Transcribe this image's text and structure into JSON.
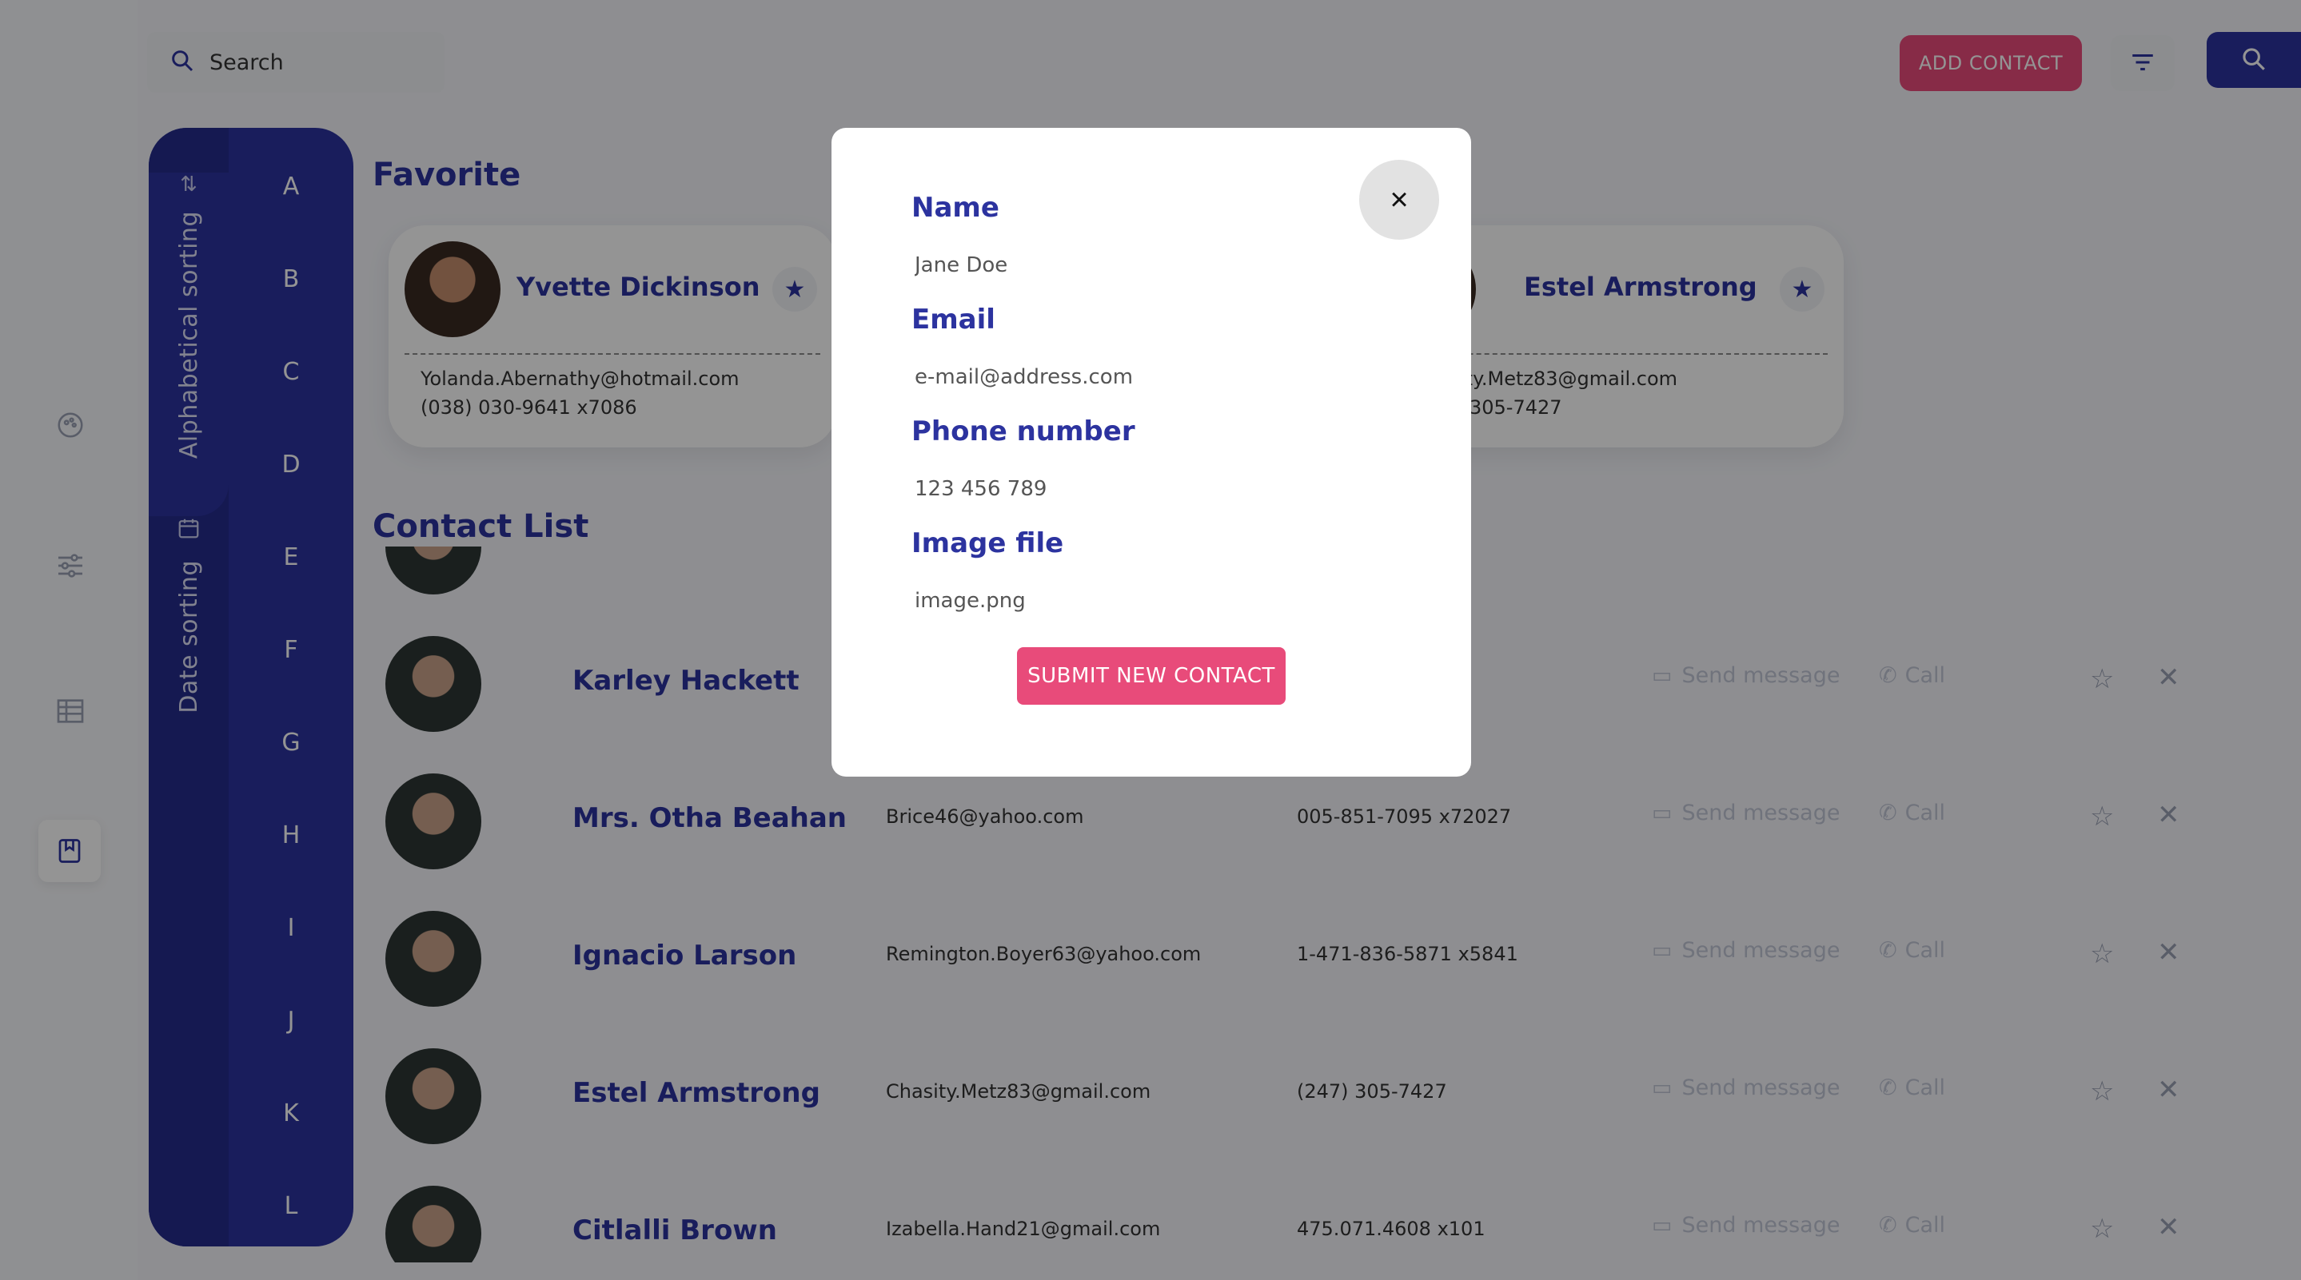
{
  "search": {
    "placeholder": "Search"
  },
  "header": {
    "add_contact_label": "ADD CONTACT"
  },
  "sidebar_icons": [
    "palette-icon",
    "sliders-icon",
    "list-icon",
    "bookmark-icon"
  ],
  "sorting": {
    "alphabetical_label": "Alphabetical sorting",
    "date_label": "Date sorting",
    "letters": [
      "A",
      "B",
      "C",
      "D",
      "E",
      "F",
      "G",
      "H",
      "I",
      "J",
      "K",
      "L"
    ]
  },
  "favorites": {
    "title": "Favorite",
    "cards": [
      {
        "name": "Yvette Dickinson",
        "email": "Yolanda.Abernathy@hotmail.com",
        "phone": "(038) 030-9641 x7086"
      },
      {
        "name": "Estel Armstrong",
        "email": "ity.Metz83@gmail.com",
        "phone": "305-7427"
      }
    ]
  },
  "contacts": {
    "title": "Contact List",
    "send_message_label": "Send message",
    "call_label": "Call",
    "rows": [
      {
        "name": "Karley Hackett",
        "email": "",
        "phone": ""
      },
      {
        "name": "Mrs. Otha Beahan",
        "email": "Brice46@yahoo.com",
        "phone": "005-851-7095 x72027"
      },
      {
        "name": "Ignacio Larson",
        "email": "Remington.Boyer63@yahoo.com",
        "phone": "1-471-836-5871 x5841"
      },
      {
        "name": "Estel Armstrong",
        "email": "Chasity.Metz83@gmail.com",
        "phone": "(247) 305-7427"
      },
      {
        "name": "Citlalli Brown",
        "email": "Izabella.Hand21@gmail.com",
        "phone": "475.071.4608 x101"
      }
    ]
  },
  "modal": {
    "close_glyph": "×",
    "name_label": "Name",
    "name_placeholder": "Jane Doe",
    "email_label": "Email",
    "email_placeholder": "e-mail@address.com",
    "phone_label": "Phone number",
    "phone_placeholder": "123 456 789",
    "image_label": "Image file",
    "image_placeholder": "image.png",
    "submit_label": "SUBMIT NEW CONTACT"
  },
  "colors": {
    "primary": "#2c339f",
    "accent": "#e84b7a",
    "overlay": "rgba(0,0,0,0.42)"
  }
}
